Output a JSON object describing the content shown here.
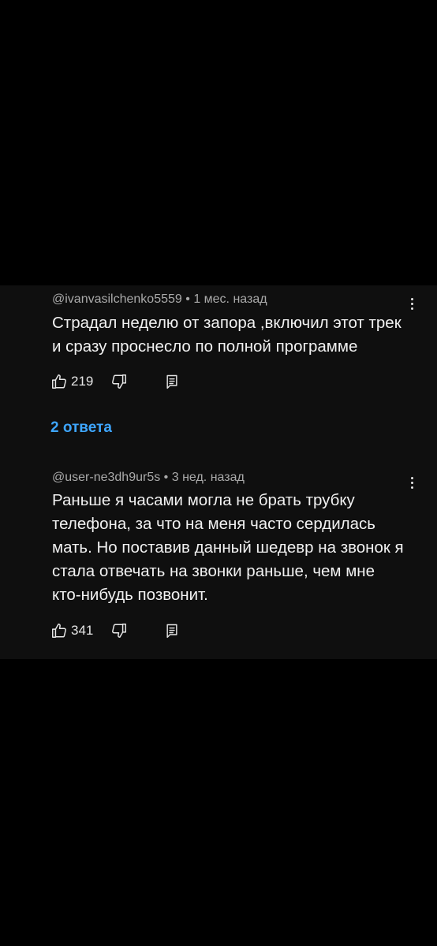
{
  "comments": [
    {
      "author": "@ivanvasilchenko5559",
      "separator": "•",
      "time": "1 мес. назад",
      "text": "Страдал неделю от запора ,включил этот трек и сразу проснесло по полной программе",
      "likes": "219"
    },
    {
      "author": "@user-ne3dh9ur5s",
      "separator": "•",
      "time": "3 нед. назад",
      "text": "Раньше я часами могла не брать трубку телефона, за что на меня часто сердилась мать. Но поставив данный шедевр на звонок я стала отвечать на звонки раньше, чем мне кто-нибудь позвонит.",
      "likes": "341"
    }
  ],
  "replies_link": "2 ответа",
  "icons": {
    "like": "thumbs-up-icon",
    "dislike": "thumbs-down-icon",
    "reply": "reply-icon",
    "more": "more-vert-icon"
  },
  "colors": {
    "background": "#000000",
    "panel": "#0f0f0f",
    "text": "#f1f1f1",
    "meta": "#aaaaaa",
    "link": "#3ea6ff"
  }
}
